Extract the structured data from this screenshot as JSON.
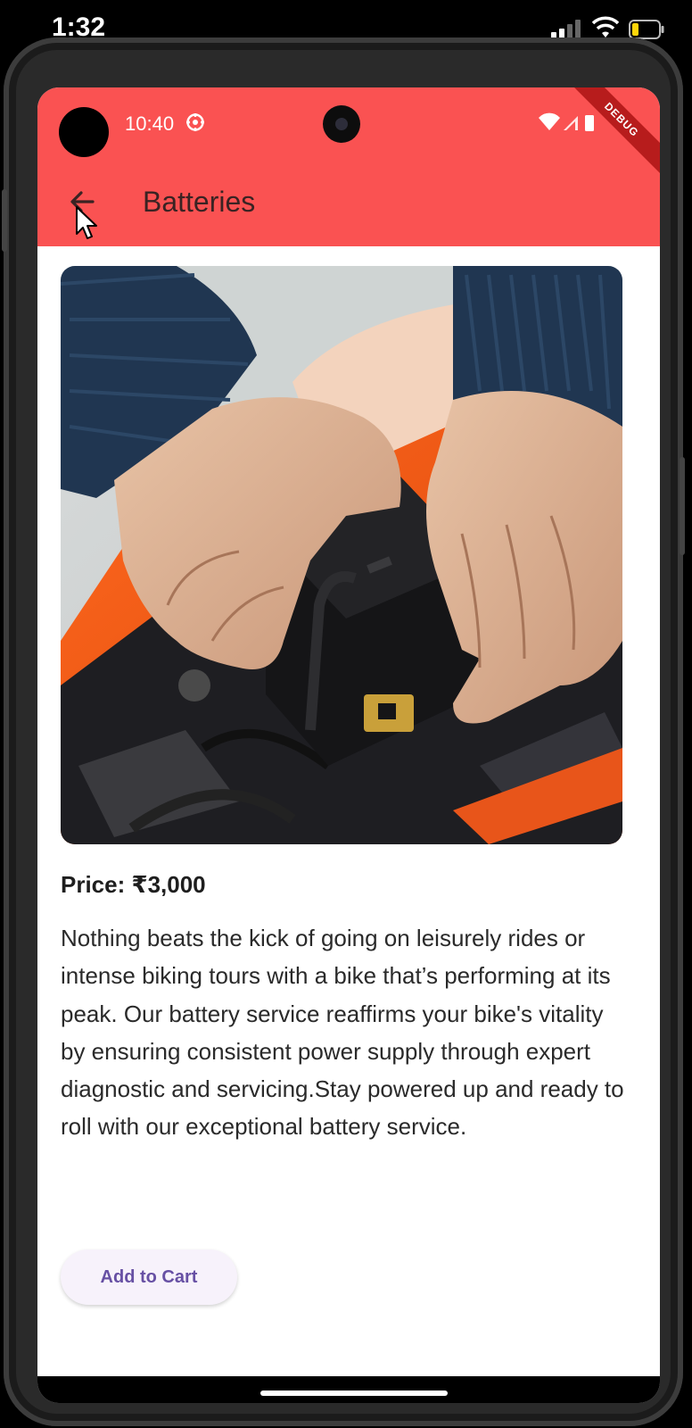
{
  "ios_status": {
    "time": "1:32",
    "signal_icon": "cellular-signal-icon",
    "wifi_icon": "wifi-icon",
    "battery_icon": "battery-icon",
    "battery_color": "#ffd60a"
  },
  "android_status": {
    "time": "10:40",
    "sync_icon": "sync-icon",
    "indicators": [
      "wifi-icon",
      "signal-icon",
      "battery-icon"
    ]
  },
  "debug_banner": "DEBUG",
  "toolbar": {
    "back_icon": "arrow-back-icon",
    "title": "Batteries",
    "background_color": "#fa5252"
  },
  "product": {
    "price": "Price: ₹3,000",
    "description": "Nothing beats the kick of going on leisurely rides or intense biking tours with a bike that’s performing at its peak. Our battery service reaffirms your bike's vitality by ensuring consistent power supply through expert diagnostic and servicing.Stay powered up and ready to roll with our exceptional battery service.",
    "add_to_cart_label": "Add to Cart",
    "button_text_color": "#6750a4"
  }
}
